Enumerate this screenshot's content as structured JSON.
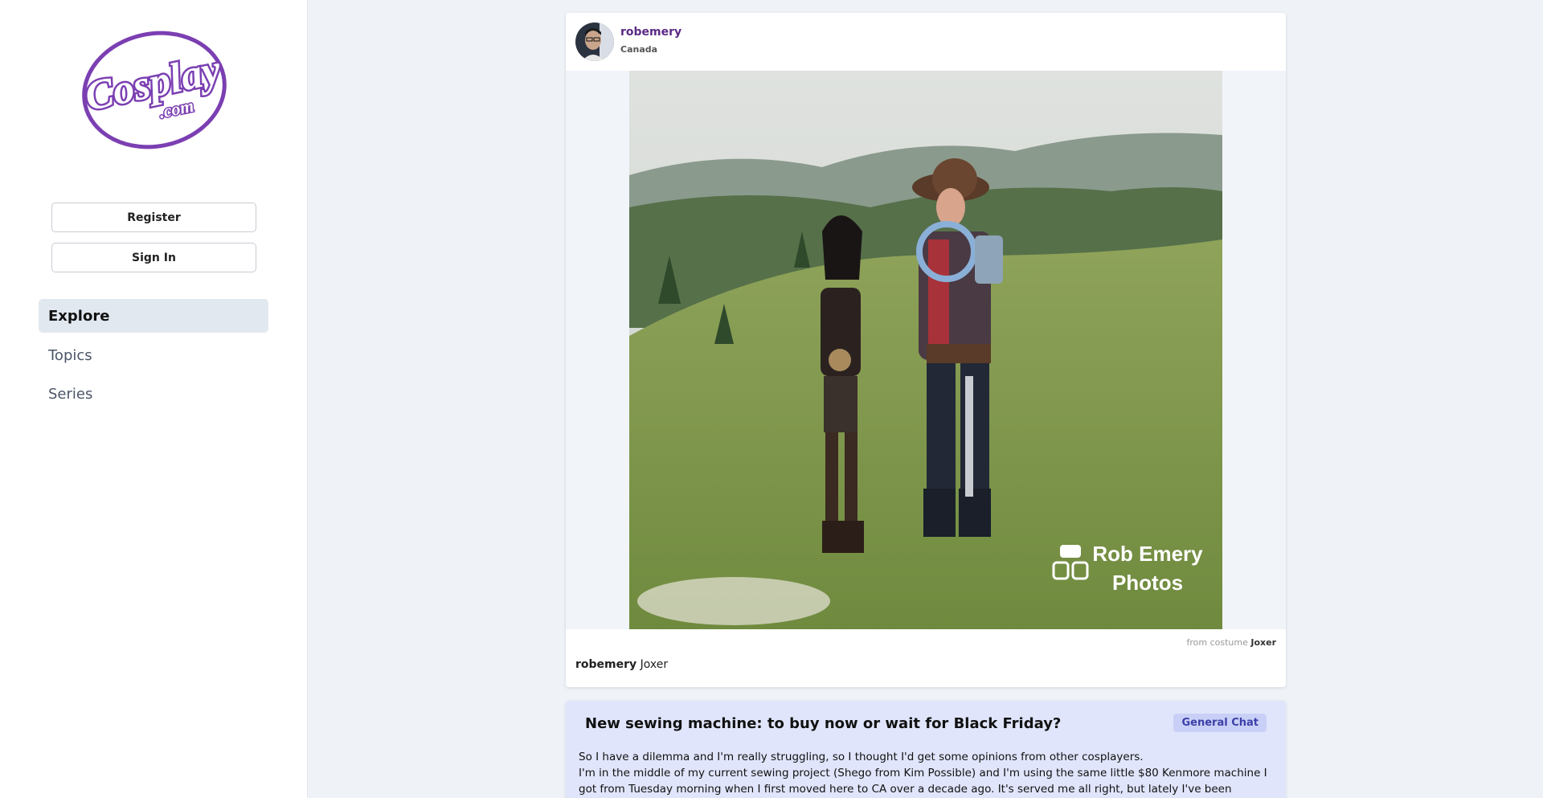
{
  "brand": {
    "logo_main": "Cosplay",
    "logo_sub": ".com",
    "accent": "#7b3fb2"
  },
  "auth": {
    "register_label": "Register",
    "signin_label": "Sign In"
  },
  "nav": {
    "explore": "Explore",
    "topics": "Topics",
    "series": "Series"
  },
  "post": {
    "username": "robemery",
    "location": "Canada",
    "watermark_line1": "Rob Emery",
    "watermark_line2": "Photos",
    "from_prefix": "from costume",
    "costume": "Joxer",
    "caption_user": "robemery",
    "caption_text": "Joxer"
  },
  "topic": {
    "title": "New sewing machine: to buy now or wait for Black Friday?",
    "badge": "General Chat",
    "body_line1": "So I have a dilemma and I'm really struggling, so I thought I'd get some opinions from other cosplayers.",
    "body_line2": "I'm in the middle of my current sewing project (Shego from Kim Possible) and I'm using the same little $80 Kenmore machine I got from Tuesday morning when I first moved here to CA over a decade ago. It's served me all right, but lately I've been fighting with it"
  }
}
